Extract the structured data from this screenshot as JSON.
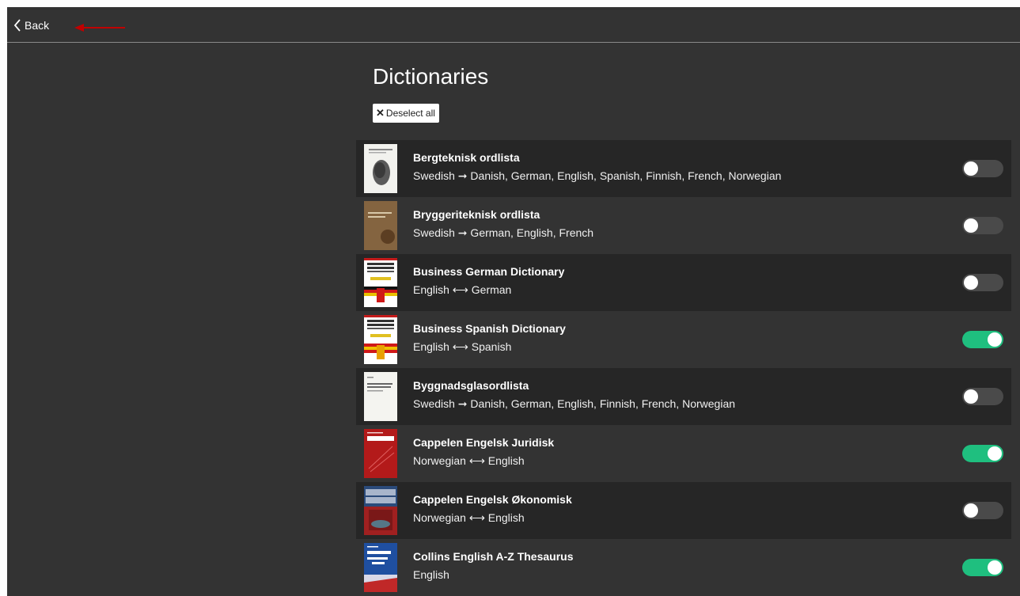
{
  "header": {
    "back_label": "Back",
    "back_icon": "chevron-left-icon",
    "annotation_arrow_color": "#c00000"
  },
  "page": {
    "title": "Dictionaries",
    "deselect_label": "Deselect all"
  },
  "colors": {
    "background": "#333333",
    "row_alt": "#262626",
    "toggle_on": "#1fbf7f",
    "toggle_off": "#4a4a4a"
  },
  "dictionaries": [
    {
      "title": "Bergteknisk ordlista",
      "languages": "Swedish ➞ Danish, German, English, Spanish, Finnish, French, Norwegian",
      "enabled": false
    },
    {
      "title": "Bryggeriteknisk  ordlista",
      "languages": "Swedish ➞ German, English, French",
      "enabled": false
    },
    {
      "title": "Business German Dictionary",
      "languages": "English ⟷ German",
      "enabled": false
    },
    {
      "title": "Business Spanish Dictionary",
      "languages": "English ⟷ Spanish",
      "enabled": true
    },
    {
      "title": "Byggnadsglasordlista",
      "languages": "Swedish ➞ Danish, German, English, Finnish, French, Norwegian",
      "enabled": false
    },
    {
      "title": "Cappelen Engelsk Juridisk",
      "languages": "Norwegian ⟷ English",
      "enabled": true
    },
    {
      "title": "Cappelen Engelsk Økonomisk",
      "languages": "Norwegian ⟷ English",
      "enabled": false
    },
    {
      "title": "Collins English A-Z Thesaurus",
      "languages": "English",
      "enabled": true
    }
  ]
}
